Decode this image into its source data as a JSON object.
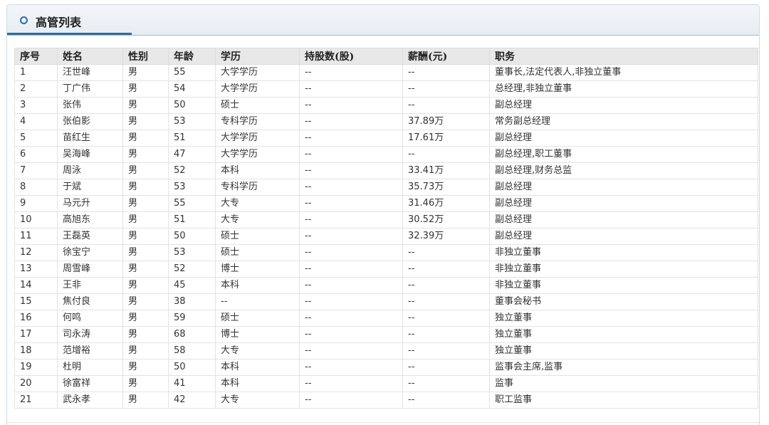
{
  "panel": {
    "title": "高管列表"
  },
  "table": {
    "headers": [
      "序号",
      "姓名",
      "性别",
      "年龄",
      "学历",
      "持股数(股)",
      "薪酬(元)",
      "职务"
    ],
    "rows": [
      [
        "1",
        "汪世峰",
        "男",
        "55",
        "大学学历",
        "--",
        "--",
        "董事长,法定代表人,非独立董事"
      ],
      [
        "2",
        "丁广伟",
        "男",
        "54",
        "大学学历",
        "--",
        "--",
        "总经理,非独立董事"
      ],
      [
        "3",
        "张伟",
        "男",
        "50",
        "硕士",
        "--",
        "--",
        "副总经理"
      ],
      [
        "4",
        "张伯影",
        "男",
        "53",
        "专科学历",
        "--",
        "37.89万",
        "常务副总经理"
      ],
      [
        "5",
        "苗红生",
        "男",
        "51",
        "大学学历",
        "--",
        "17.61万",
        "副总经理"
      ],
      [
        "6",
        "吴海峰",
        "男",
        "47",
        "大学学历",
        "--",
        "--",
        "副总经理,职工董事"
      ],
      [
        "7",
        "周泳",
        "男",
        "52",
        "本科",
        "--",
        "33.41万",
        "副总经理,财务总监"
      ],
      [
        "8",
        "于斌",
        "男",
        "53",
        "专科学历",
        "--",
        "35.73万",
        "副总经理"
      ],
      [
        "9",
        "马元升",
        "男",
        "55",
        "大专",
        "--",
        "31.46万",
        "副总经理"
      ],
      [
        "10",
        "高旭东",
        "男",
        "51",
        "大专",
        "--",
        "30.52万",
        "副总经理"
      ],
      [
        "11",
        "王磊英",
        "男",
        "50",
        "硕士",
        "--",
        "32.39万",
        "副总经理"
      ],
      [
        "12",
        "徐宝宁",
        "男",
        "53",
        "硕士",
        "--",
        "--",
        "非独立董事"
      ],
      [
        "13",
        "周雪峰",
        "男",
        "52",
        "博士",
        "--",
        "--",
        "非独立董事"
      ],
      [
        "14",
        "王非",
        "男",
        "45",
        "本科",
        "--",
        "--",
        "非独立董事"
      ],
      [
        "15",
        "焦付良",
        "男",
        "38",
        "--",
        "--",
        "--",
        "董事会秘书"
      ],
      [
        "16",
        "何鸣",
        "男",
        "59",
        "硕士",
        "--",
        "--",
        "独立董事"
      ],
      [
        "17",
        "司永涛",
        "男",
        "68",
        "博士",
        "--",
        "--",
        "独立董事"
      ],
      [
        "18",
        "范增裕",
        "男",
        "58",
        "大专",
        "--",
        "--",
        "独立董事"
      ],
      [
        "19",
        "杜明",
        "男",
        "50",
        "本科",
        "--",
        "--",
        "监事会主席,监事"
      ],
      [
        "20",
        "徐富祥",
        "男",
        "41",
        "本科",
        "--",
        "--",
        "监事"
      ],
      [
        "21",
        "武永孝",
        "男",
        "42",
        "大专",
        "--",
        "--",
        "职工监事"
      ]
    ]
  }
}
